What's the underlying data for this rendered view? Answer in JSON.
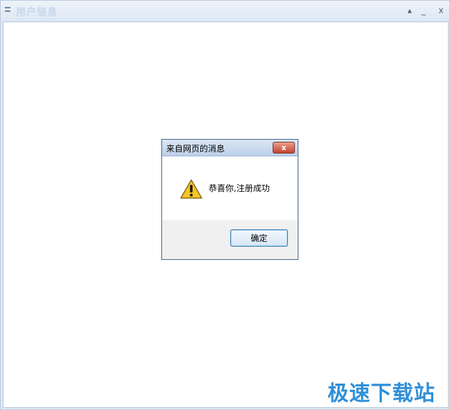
{
  "window": {
    "title": "用户信息",
    "controls": {
      "restore": "▴",
      "minimize": "_",
      "close": "x"
    }
  },
  "dialog": {
    "title": "来自网页的消息",
    "close_label": "x",
    "icon": "warning-icon",
    "message": "恭喜你,注册成功",
    "ok_label": "确定"
  },
  "watermark": {
    "text": "极速下载站"
  },
  "colors": {
    "window_frame": "#dfe8f5",
    "dialog_border": "#45638f",
    "close_button": "#c8402d",
    "watermark": "#2f8fd8"
  }
}
